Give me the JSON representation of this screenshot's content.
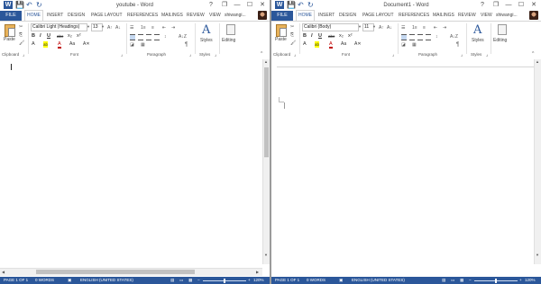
{
  "windows": [
    {
      "title": "youtube - Word",
      "tabs": {
        "file": "FILE",
        "home": "HOME",
        "insert": "INSERT",
        "design": "DESIGN",
        "page_layout": "PAGE LAYOUT",
        "references": "REFERENCES",
        "mailings": "MAILINGS",
        "review": "REVIEW",
        "view": "VIEW"
      },
      "user": "shiwangi...",
      "font_name": "Calibri Light (Headings)",
      "font_size": "13",
      "groups": {
        "clipboard": "Clipboard",
        "font": "Font",
        "paragraph": "Paragraph",
        "styles": "Styles"
      },
      "paste": "Paste",
      "styles_btn": "Styles",
      "editing_btn": "Editing",
      "status": {
        "page": "PAGE 1 OF 1",
        "words": "0 WORDS",
        "language": "ENGLISH (UNITED STATES)",
        "zoom": "120%"
      },
      "zoom_fraction": 0.5
    },
    {
      "title": "Document1 - Word",
      "tabs": {
        "file": "FILE",
        "home": "HOME",
        "insert": "INSERT",
        "design": "DESIGN",
        "page_layout": "PAGE LAYOUT",
        "references": "REFERENCES",
        "mailings": "MAILINGS",
        "review": "REVIEW",
        "view": "VIEW"
      },
      "user": "shiwangi...",
      "font_name": "Calibri (Body)",
      "font_size": "11",
      "groups": {
        "clipboard": "Clipboard",
        "font": "Font",
        "paragraph": "Paragraph",
        "styles": "Styles"
      },
      "paste": "Paste",
      "styles_btn": "Styles",
      "editing_btn": "Editing",
      "status": {
        "page": "PAGE 1 OF 1",
        "words": "0 WORDS",
        "language": "ENGLISH (UNITED STATES)",
        "zoom": "120%"
      },
      "zoom_fraction": 0.5
    }
  ],
  "glyphs": {
    "save": "💾",
    "undo": "↶",
    "redo": "↻",
    "help": "?",
    "restore": "❐",
    "minimize": "—",
    "maximize": "☐",
    "close": "✕",
    "bold": "B",
    "italic": "I",
    "underline": "U",
    "strike": "abc",
    "sub": "x₂",
    "sup": "x²",
    "font_color": "A",
    "highlight": "ab",
    "grow": "A↑",
    "shrink": "A↓",
    "clear": "A✕",
    "aa": "Aa",
    "pilcrow": "¶",
    "bullets": "☰",
    "numbering": "1≡",
    "multilevel": "≡",
    "indent_dec": "⇤",
    "indent_inc": "⇥",
    "sort": "A↓Z",
    "styles": "A",
    "launcher": "⌟",
    "collapse": "^",
    "up": "▲",
    "down": "▼",
    "left": "◀",
    "right": "▶",
    "view_read": "▤",
    "view_print": "▭",
    "view_web": "▦",
    "minus": "−",
    "plus": "+"
  },
  "colors": {
    "accent": "#2b579a",
    "status_bar": "#2b579a"
  }
}
